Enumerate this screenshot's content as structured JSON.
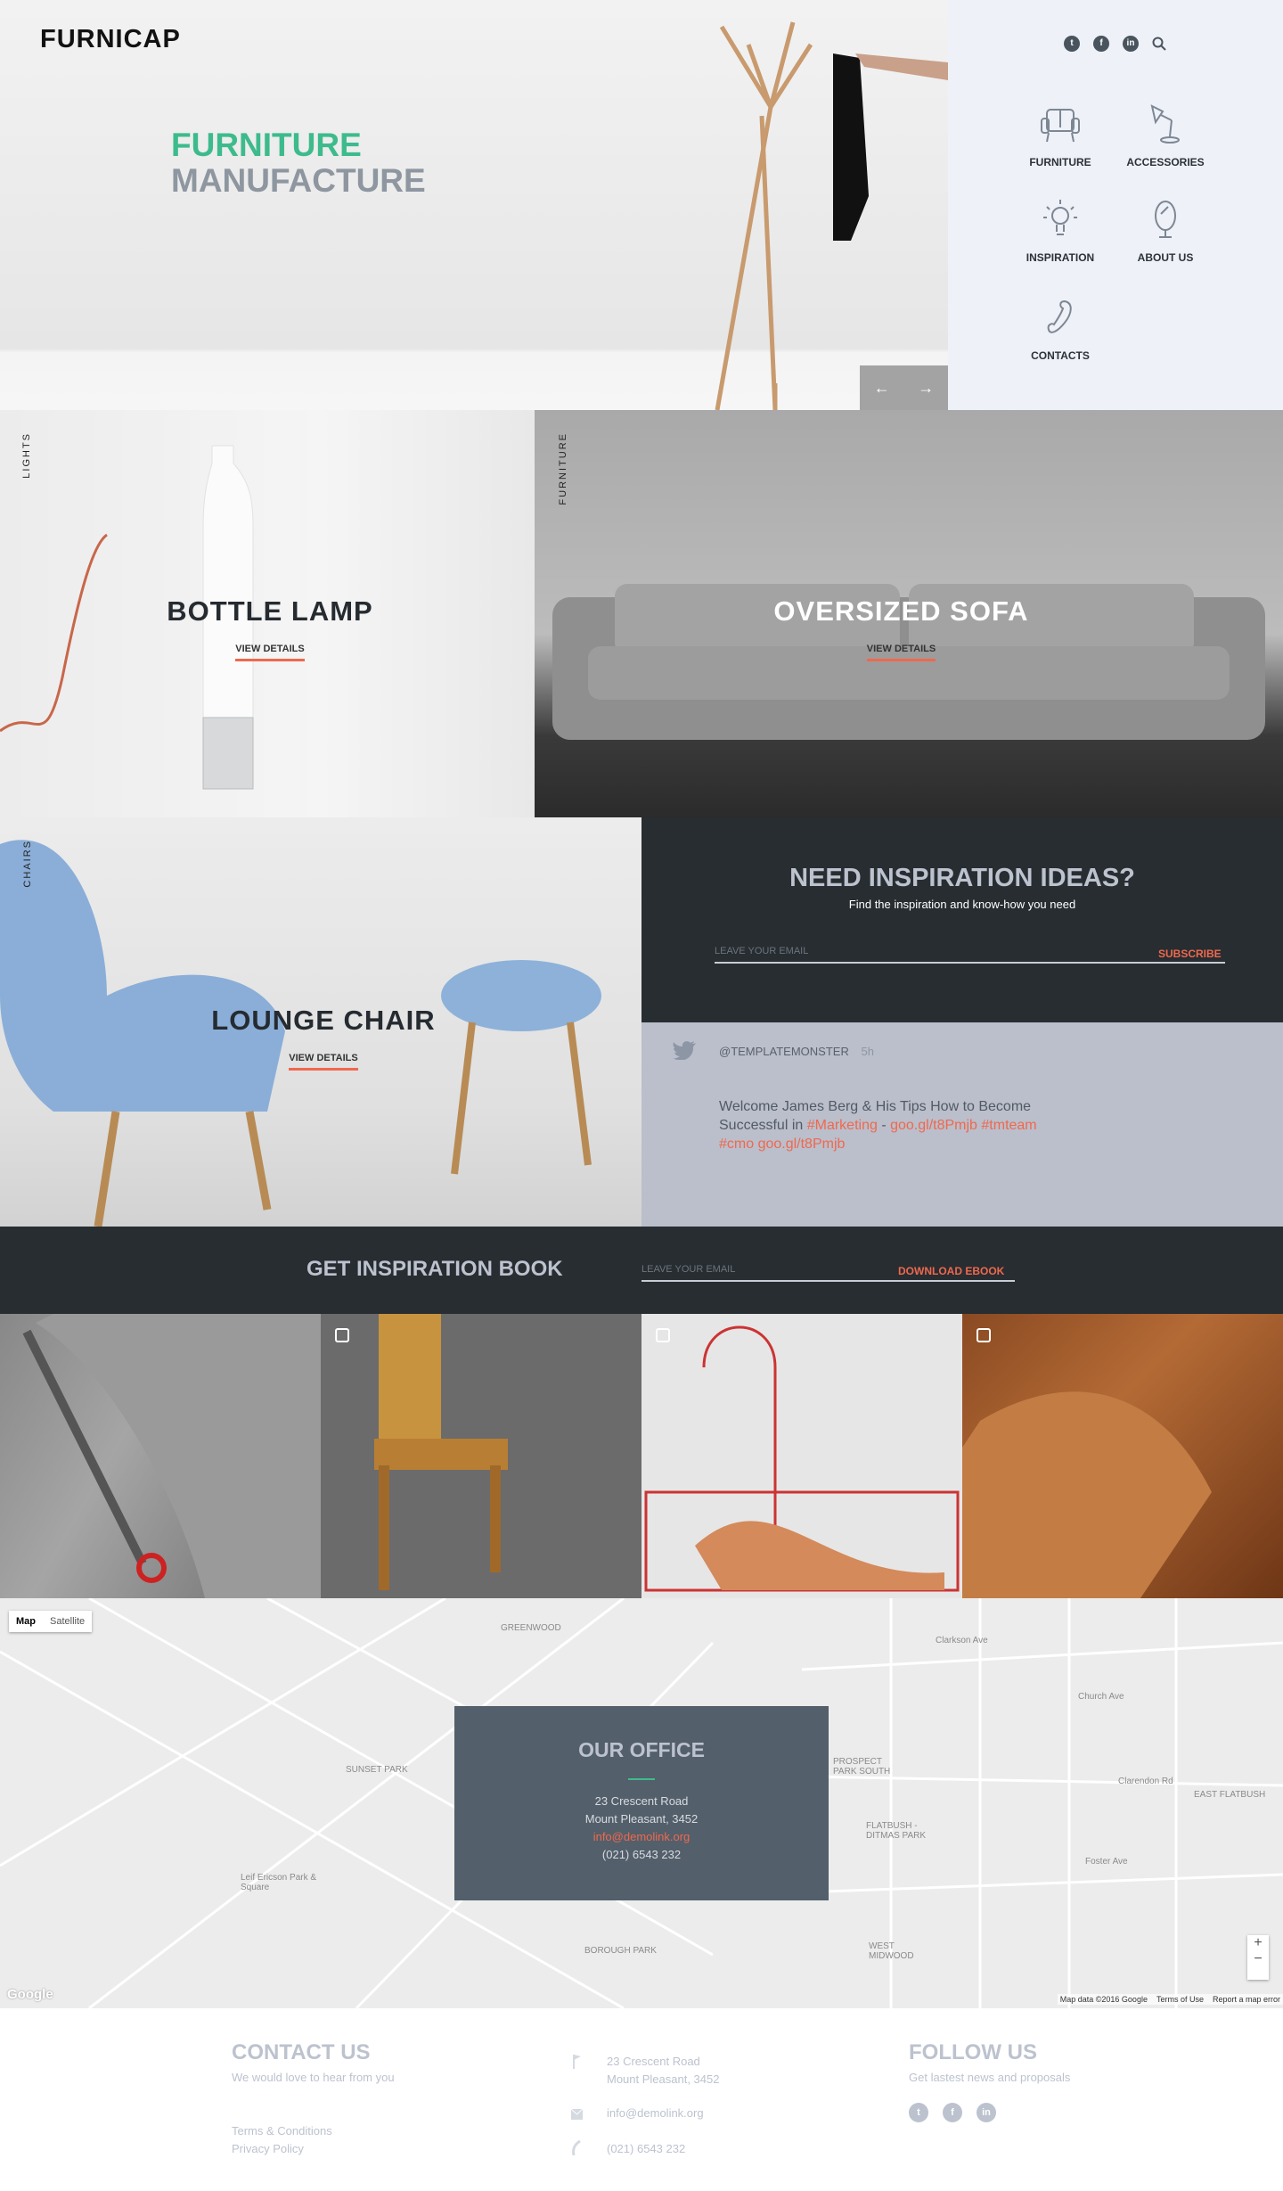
{
  "brand": {
    "logo": "FURNICAP"
  },
  "hero": {
    "title_line1": "FURNITURE",
    "title_line2": "MANUFACTURE",
    "prev": "←",
    "next": "→"
  },
  "header": {
    "social": [
      "twitter",
      "facebook",
      "linkedin"
    ],
    "search_icon": "search-icon"
  },
  "nav": [
    {
      "label": "FURNITURE",
      "icon": "armchair-icon"
    },
    {
      "label": "ACCESSORIES",
      "icon": "desk-lamp-icon"
    },
    {
      "label": "INSPIRATION",
      "icon": "lightbulb-icon"
    },
    {
      "label": "ABOUT US",
      "icon": "mirror-icon"
    },
    {
      "label": "CONTACTS",
      "icon": "phone-icon"
    }
  ],
  "products": [
    {
      "category": "LIGHTS",
      "title": "BOTTLE LAMP",
      "link": "VIEW DETAILS"
    },
    {
      "category": "FURNITURE",
      "title": "OVERSIZED SOFA",
      "link": "VIEW DETAILS"
    },
    {
      "category": "CHAIRS",
      "title": "LOUNGE CHAIR",
      "link": "VIEW DETAILS"
    }
  ],
  "subscribe": {
    "title": "NEED INSPIRATION IDEAS?",
    "subtitle": "Find the inspiration and know-how you need",
    "placeholder": "LEAVE YOUR EMAIL",
    "button": "SUBSCRIBE"
  },
  "tweet": {
    "handle": "@TEMPLATEMONSTER",
    "time": "5h",
    "text": "Welcome James Berg & His Tips How to Become Successful in ",
    "tag": "#Marketing",
    "dash": " -",
    "links": "goo.gl/t8Pmjb #tmteam #cmo goo.gl/t8Pmjb"
  },
  "book": {
    "title": "GET INSPIRATION BOOK",
    "placeholder": "LEAVE YOUR EMAIL",
    "button": "DOWNLOAD EBOOK"
  },
  "map": {
    "tab_map": "Map",
    "tab_satellite": "Satellite",
    "labels": [
      "GREENWOOD",
      "SUNSET PARK",
      "PROSPECT PARK SOUTH",
      "FLATBUSH - DITMAS PARK",
      "EAST FLATBUSH",
      "BOROUGH PARK",
      "WEST MIDWOOD",
      "Leif Ericson Park & Square",
      "Clarkson Ave",
      "Clarendon Rd",
      "Church Ave",
      "Foster Ave"
    ],
    "attribution": "Map data ©2016 Google",
    "terms": "Terms of Use",
    "report": "Report a map error",
    "google": "Google",
    "zoom_in": "+",
    "zoom_out": "−"
  },
  "office": {
    "title": "OUR OFFICE",
    "address1": "23 Crescent Road",
    "address2": "Mount Pleasant, 3452",
    "email": "info@demolink.org",
    "phone": "(021) 6543 232"
  },
  "footer": {
    "contact_title": "CONTACT US",
    "contact_sub": "We would love to hear from you",
    "terms": "Terms & Conditions",
    "privacy": "Privacy Policy",
    "address1": "23 Crescent Road",
    "address2": "Mount Pleasant, 3452",
    "email": "info@demolink.org",
    "phone": "(021) 6543 232",
    "follow_title": "FOLLOW US",
    "follow_sub": "Get lastest news and proposals"
  },
  "colors": {
    "green": "#3dbb8c",
    "accent": "#f0684e",
    "dark": "#272d31",
    "panel": "#eef1f7",
    "tweet_bg": "#babfcb",
    "office_bg": "#535f6a"
  }
}
